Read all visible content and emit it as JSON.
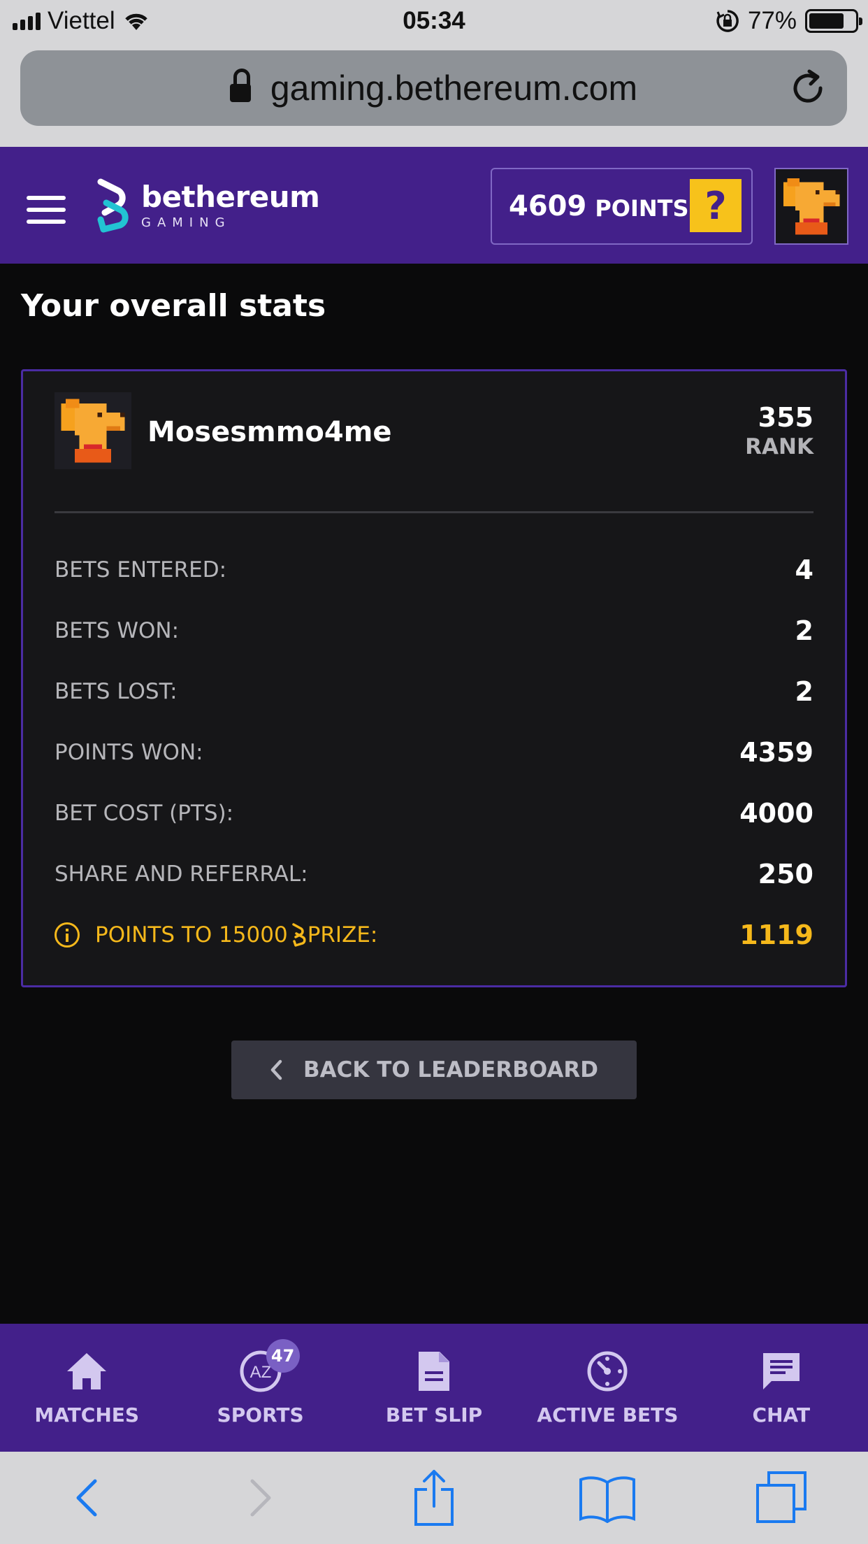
{
  "status_bar": {
    "carrier": "Viettel",
    "time": "05:34",
    "battery": "77%",
    "battery_level": 0.77
  },
  "browser": {
    "url": "gaming.bethereum.com"
  },
  "header": {
    "logo_name": "bethereum",
    "logo_sub": "GAMING",
    "points_value": "4609",
    "points_label": "POINTS",
    "help_label": "?"
  },
  "page": {
    "title": "Your overall stats"
  },
  "profile": {
    "username": "Mosesmmo4me",
    "rank_value": "355",
    "rank_label": "RANK"
  },
  "stats": [
    {
      "label": "BETS ENTERED:",
      "value": "4"
    },
    {
      "label": "BETS WON:",
      "value": "2"
    },
    {
      "label": "BETS LOST:",
      "value": "2"
    },
    {
      "label": "POINTS WON:",
      "value": "4359"
    },
    {
      "label": "BET COST (PTS):",
      "value": "4000"
    },
    {
      "label": "SHARE AND REFERRAL:",
      "value": "250"
    }
  ],
  "prize": {
    "label_before": "POINTS TO 15000",
    "label_after": "PRIZE:",
    "value": "1119"
  },
  "back_button": {
    "label": "BACK TO LEADERBOARD"
  },
  "bottom_nav": [
    {
      "label": "MATCHES",
      "icon": "home-icon"
    },
    {
      "label": "SPORTS",
      "icon": "az-icon",
      "badge": "47",
      "icon_text": "AZ"
    },
    {
      "label": "BET SLIP",
      "icon": "document-icon"
    },
    {
      "label": "ACTIVE BETS",
      "icon": "timer-icon"
    },
    {
      "label": "CHAT",
      "icon": "chat-icon"
    }
  ],
  "colors": {
    "brand_purple": "#43208a",
    "accent_yellow": "#f7c21b",
    "prize_gold": "#f5b81b"
  }
}
